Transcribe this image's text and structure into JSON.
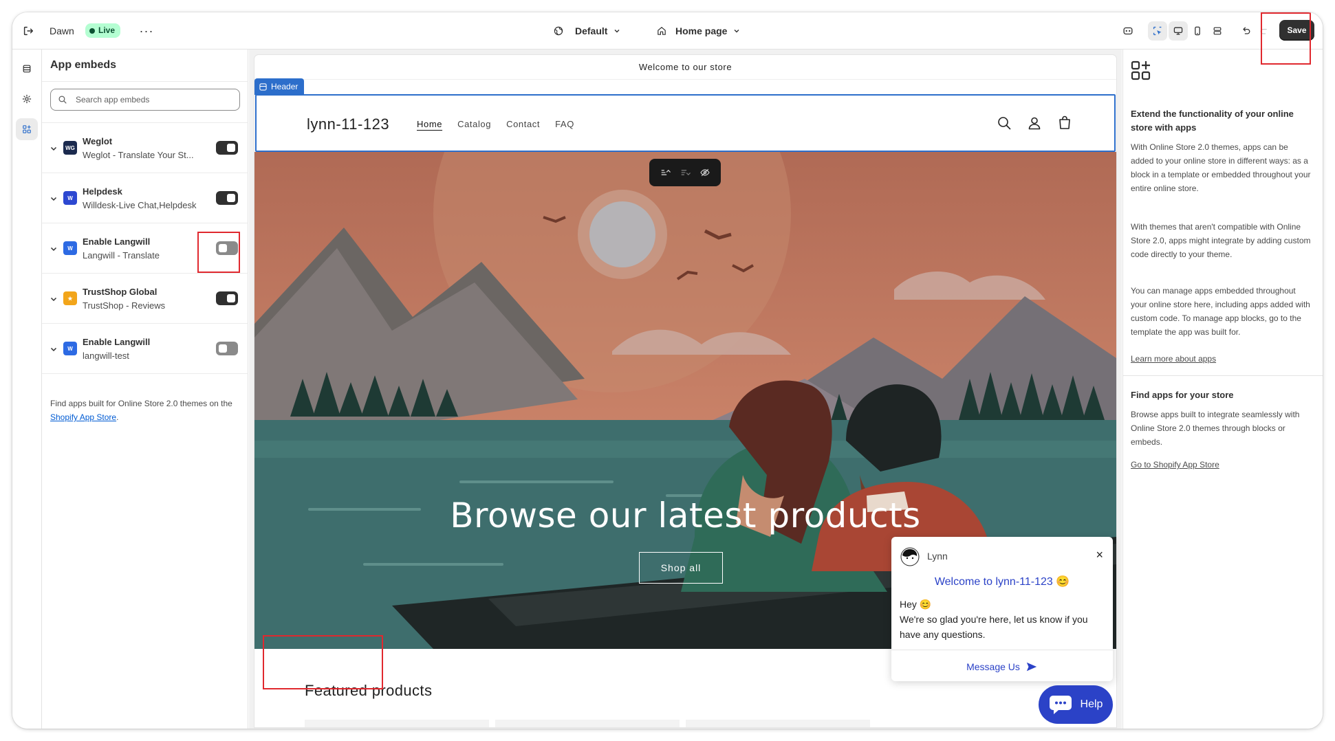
{
  "topbar": {
    "theme_name": "Dawn",
    "live_badge": "Live",
    "more_label": "···",
    "template_selector": "Default",
    "page_selector": "Home page",
    "save_label": "Save"
  },
  "rail": {
    "items": [
      "sections-icon",
      "settings-icon",
      "app-embeds-icon"
    ],
    "active": "app-embeds-icon"
  },
  "left_panel": {
    "title": "App embeds",
    "search_placeholder": "Search app embeds",
    "embeds": [
      {
        "name": "Weglot",
        "subtitle": "Weglot - Translate Your St...",
        "enabled": true,
        "icon_text": "WG",
        "icon_color": "#1b2a4e"
      },
      {
        "name": "Helpdesk",
        "subtitle": "Willdesk-Live Chat,Helpdesk",
        "enabled": true,
        "icon_text": "W",
        "icon_color": "#2d48d1"
      },
      {
        "name": "Enable Langwill",
        "subtitle": "Langwill - Translate",
        "enabled": false,
        "icon_text": "W",
        "icon_color": "#2d6ae3"
      },
      {
        "name": "TrustShop Global",
        "subtitle": "TrustShop - Reviews",
        "enabled": true,
        "icon_text": "★",
        "icon_color": "#f2a51a"
      },
      {
        "name": "Enable Langwill",
        "subtitle": "langwill-test",
        "enabled": false,
        "icon_text": "W",
        "icon_color": "#2d6ae3"
      }
    ],
    "footer_text": "Find apps built for Online Store 2.0 themes on the",
    "footer_link": "Shopify App Store",
    "footer_end": "."
  },
  "preview": {
    "announcement": "Welcome to our store",
    "header_tag": "Header",
    "store_name": "lynn-11-123",
    "nav": [
      "Home",
      "Catalog",
      "Contact",
      "FAQ"
    ],
    "hero_title": "Browse our latest products",
    "hero_button": "Shop all",
    "featured_title": "Featured products",
    "chat": {
      "agent": "Lynn",
      "welcome": "Welcome to lynn-11-123 😊",
      "greeting": "Hey 😊",
      "message": "We're so glad you're here, let us know if you have any questions.",
      "cta": "Message Us",
      "close": "×"
    },
    "help_button": "Help"
  },
  "right_panel": {
    "heading": "Extend the functionality of your online store with apps",
    "para1": "With Online Store 2.0 themes, apps can be added to your online store in different ways: as a block in a template or embedded throughout your entire online store.",
    "para2": "With themes that aren't compatible with Online Store 2.0, apps might integrate by adding custom code directly to your theme.",
    "para3": "You can manage apps embedded throughout your online store here, including apps added with custom code. To manage app blocks, go to the template the app was built for.",
    "learn_link": "Learn more about apps",
    "heading2": "Find apps for your store",
    "para4": "Browse apps built to integrate seamlessly with Online Store 2.0 themes through blocks or embeds.",
    "store_link": "Go to Shopify App Store"
  },
  "colors": {
    "accent": "#2c6ecb",
    "highlight": "#e0282e",
    "chat_brand": "#2b42c7",
    "live_badge": "#b4fed2"
  }
}
